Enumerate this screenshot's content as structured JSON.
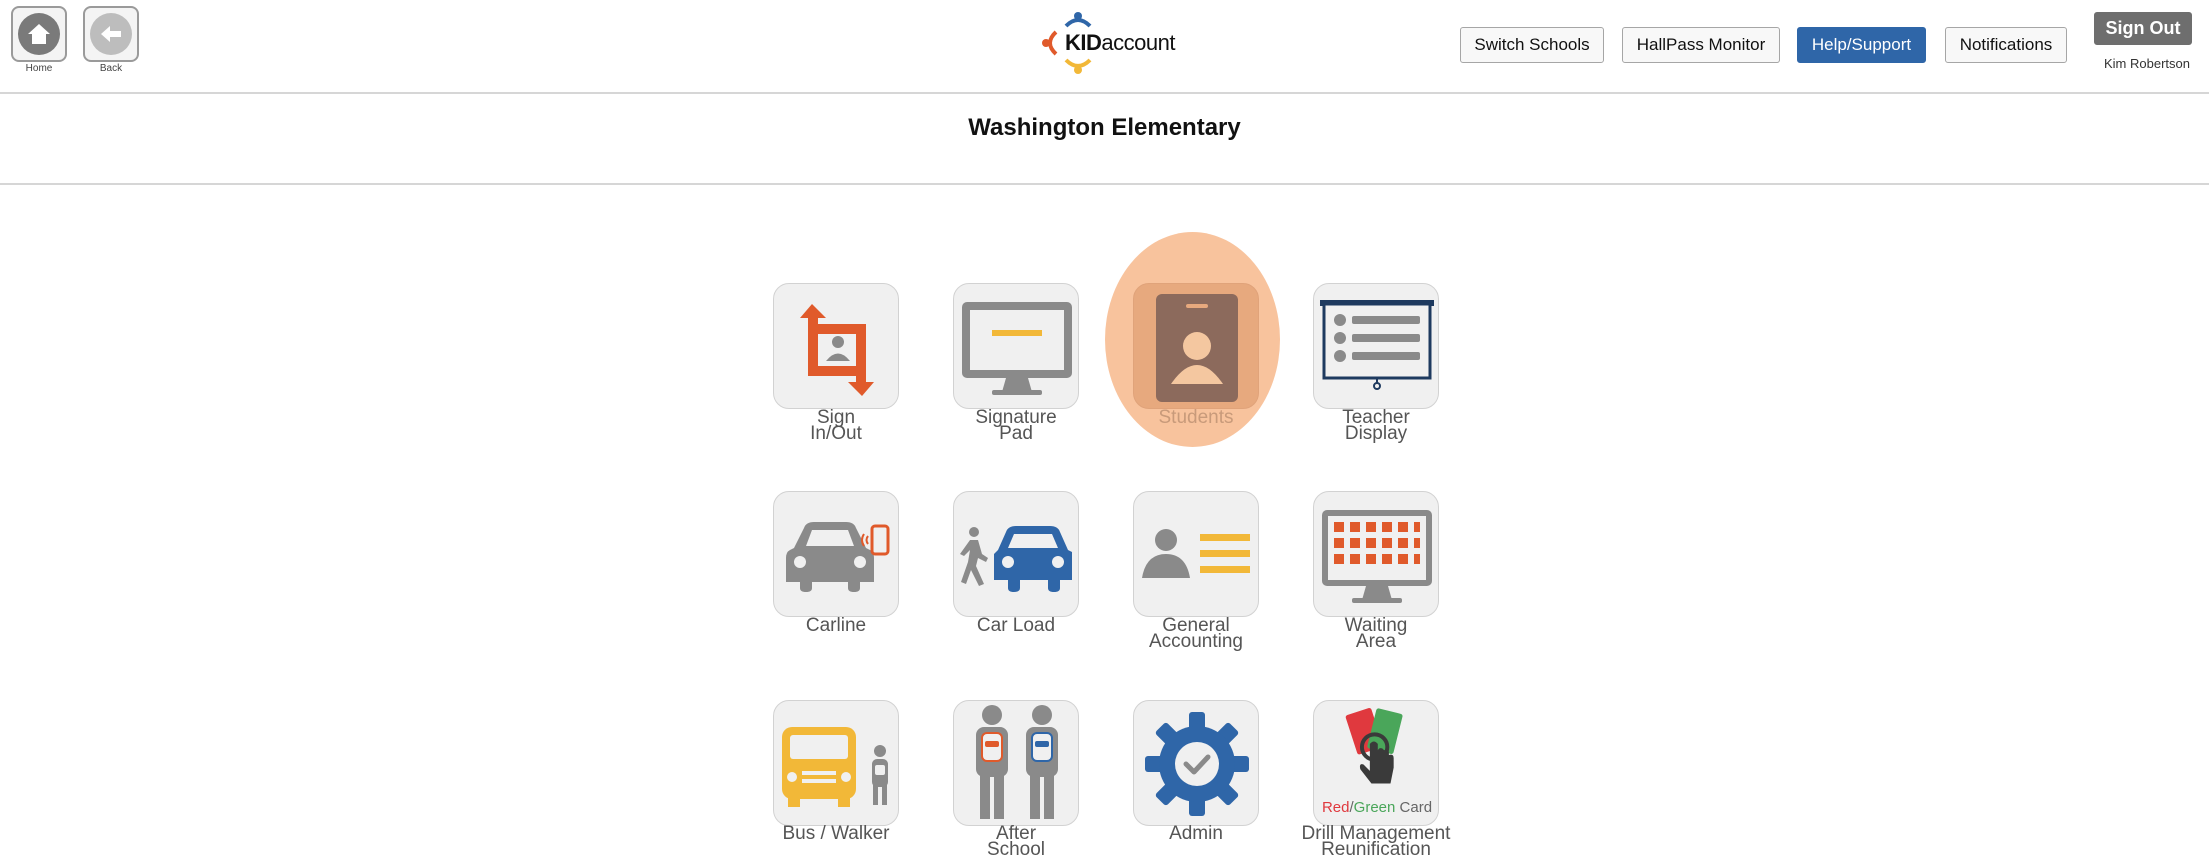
{
  "header": {
    "home_label": "Home",
    "back_label": "Back",
    "logo_prefix": "KID",
    "logo_suffix": "account",
    "buttons": {
      "switch_schools": "Switch Schools",
      "hallpass_monitor": "HallPass Monitor",
      "help_support": "Help/Support",
      "notifications": "Notifications",
      "sign_out": "Sign Out"
    },
    "user_name": "Kim Robertson"
  },
  "page": {
    "school_name": "Washington Elementary"
  },
  "tiles": {
    "sign_in_out": [
      "Sign",
      "In/Out"
    ],
    "signature_pad": [
      "Signature",
      "Pad"
    ],
    "students": [
      "Students"
    ],
    "teacher_display": [
      "Teacher",
      "Display"
    ],
    "carline": [
      "Carline"
    ],
    "car_load": [
      "Car Load"
    ],
    "general_accounting": [
      "General",
      "Accounting"
    ],
    "waiting_area": [
      "Waiting",
      "Area"
    ],
    "bus_walker": [
      "Bus / Walker"
    ],
    "after_school": [
      "After",
      "School"
    ],
    "admin": [
      "Admin"
    ],
    "drill_management": [
      "Drill Management",
      "Reunification"
    ]
  },
  "red_green_card": {
    "red": "Red",
    "slash": "/",
    "green": "Green",
    "card": " Card"
  },
  "colors": {
    "primary_blue": "#2f66a8",
    "accent_orange": "#e05a2b",
    "accent_yellow": "#f2b838",
    "highlight": "#f7b98c",
    "icon_gray": "#8a8a8a"
  }
}
